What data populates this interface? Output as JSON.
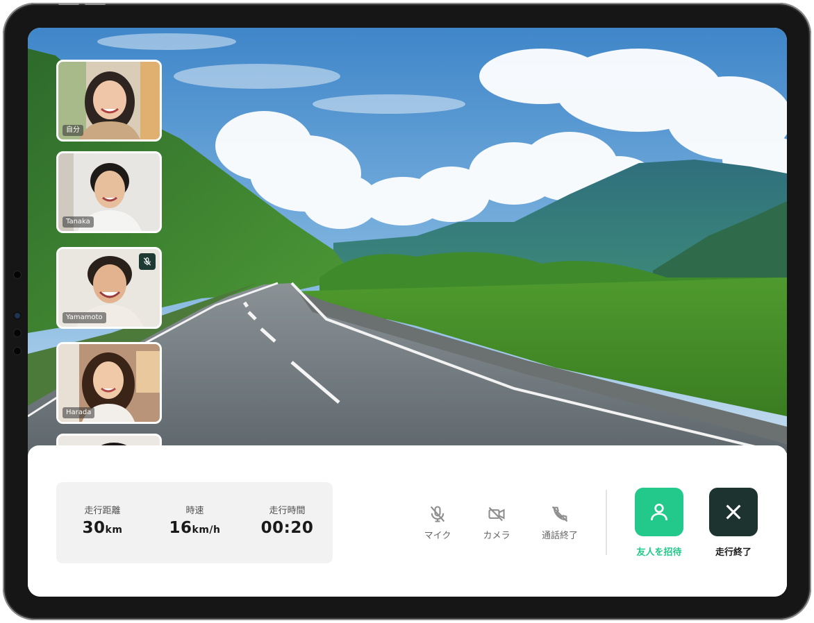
{
  "participants": [
    {
      "name": "自分",
      "muted": false,
      "tile": "self-video-tile"
    },
    {
      "name": "Tanaka",
      "muted": false,
      "tile": "participant-tile-tanaka"
    },
    {
      "name": "Yamamoto",
      "muted": true,
      "tile": "participant-tile-yamamoto"
    },
    {
      "name": "Harada",
      "muted": false,
      "tile": "participant-tile-harada"
    }
  ],
  "stats": {
    "distance": {
      "label": "走行距離",
      "value": "30",
      "unit": "km"
    },
    "speed": {
      "label": "時速",
      "value": "16",
      "unit": "km/h"
    },
    "time": {
      "label": "走行時間",
      "value": "00:20",
      "unit": ""
    }
  },
  "controls": {
    "mic": {
      "label": "マイク",
      "icon": "mic-off-icon"
    },
    "camera": {
      "label": "カメラ",
      "icon": "camera-off-icon"
    },
    "end_call": {
      "label": "通話終了",
      "icon": "phone-off-icon"
    }
  },
  "actions": {
    "invite": {
      "label": "友人を招待",
      "icon": "person-icon",
      "color": "#22c98a"
    },
    "finish": {
      "label": "走行終了",
      "icon": "close-icon",
      "color": "#1c3330"
    }
  }
}
